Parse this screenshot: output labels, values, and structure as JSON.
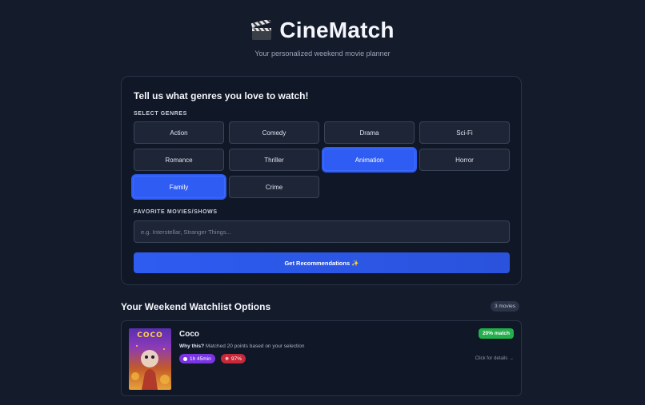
{
  "app": {
    "icon": "clapperboard-icon",
    "title": "CineMatch",
    "subtitle": "Your personalized weekend movie planner"
  },
  "form": {
    "heading": "Tell us what genres you love to watch!",
    "genres_label": "SELECT GENRES",
    "genres": [
      {
        "label": "Action",
        "selected": false
      },
      {
        "label": "Comedy",
        "selected": false
      },
      {
        "label": "Drama",
        "selected": false
      },
      {
        "label": "Sci-Fi",
        "selected": false
      },
      {
        "label": "Romance",
        "selected": false
      },
      {
        "label": "Thriller",
        "selected": false
      },
      {
        "label": "Animation",
        "selected": true
      },
      {
        "label": "Horror",
        "selected": false
      },
      {
        "label": "Family",
        "selected": true
      },
      {
        "label": "Crime",
        "selected": false
      }
    ],
    "favorites_label": "FAVORITE MOVIES/SHOWS",
    "favorites_value": "",
    "favorites_placeholder": "e.g. Interstellar, Stranger Things...",
    "submit_label": "Get Recommendations ✨"
  },
  "watchlist": {
    "heading": "Your Weekend Watchlist Options",
    "count": "3 movies",
    "movies": [
      {
        "poster_title": "COCO",
        "title": "Coco",
        "why_label": "Why this?",
        "why_text": "Matched 20 points based on your selection",
        "runtime": "1h 45min",
        "rating": "97%",
        "match": "20% match",
        "details": "Click for details →"
      }
    ]
  },
  "colors": {
    "background": "#141b2b",
    "accent": "#2f5cf2",
    "match_green": "#22b04a",
    "runtime_purple": "#7a35e3",
    "rating_red": "#c7283a"
  }
}
